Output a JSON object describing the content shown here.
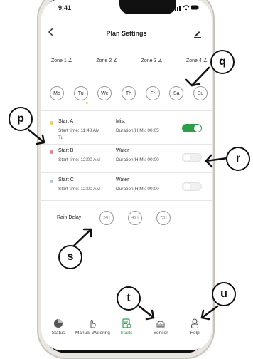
{
  "status_bar": {
    "time": "9:41",
    "icons": "..ll ᯤ ▬"
  },
  "nav": {
    "back_icon": "chevron-left-icon",
    "title": "Plan Settings",
    "edit_icon": "pencil-icon"
  },
  "zones": [
    "Zone 1",
    "Zone 2",
    "Zone 3",
    "Zone 4"
  ],
  "zone_edit_glyph": "∠",
  "days": [
    "Mo",
    "Tu",
    "We",
    "Th",
    "Fr",
    "Sa",
    "Su"
  ],
  "starts": [
    {
      "name": "Start A",
      "start_time": "Start time: 11:48 AM",
      "extra": "Tu",
      "mode": "Mist",
      "duration": "Duration(H:M): 00:05",
      "enabled": true,
      "dot_color": "#f2d24b"
    },
    {
      "name": "Start B",
      "start_time": "Start time: 12:00 AM",
      "extra": "",
      "mode": "Water",
      "duration": "Duration(H:M): 00:00",
      "enabled": false,
      "dot_color": "#f08080"
    },
    {
      "name": "Start C",
      "start_time": "Start time: 12:00 AM",
      "extra": "",
      "mode": "Water",
      "duration": "Duration(H:M): 00:00",
      "enabled": false,
      "dot_color": "#a8c6ea"
    }
  ],
  "rain_delay": {
    "label": "Rain Delay",
    "options": [
      "24H",
      "48H",
      "72H"
    ]
  },
  "tabs": [
    {
      "label": "Status",
      "icon": "pie-chart-icon"
    },
    {
      "label": "Manual Watering",
      "icon": "hand-tap-icon"
    },
    {
      "label": "Starts",
      "icon": "schedule-icon"
    },
    {
      "label": "Sensor",
      "icon": "sensor-icon"
    },
    {
      "label": "Help",
      "icon": "person-icon"
    }
  ],
  "callouts": [
    "p",
    "q",
    "r",
    "s",
    "t",
    "u"
  ],
  "colors": {
    "accent": "#2e9e4a"
  }
}
